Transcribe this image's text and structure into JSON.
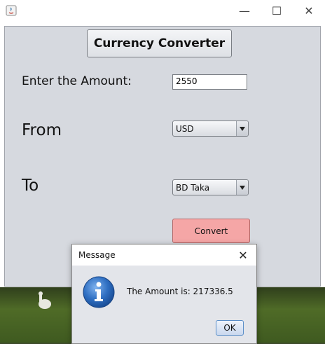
{
  "window": {
    "minimize_glyph": "—",
    "maximize_glyph": "☐",
    "close_glyph": "✕"
  },
  "form": {
    "title_button": "Currency Converter",
    "amount_label": "Enter the Amount:",
    "amount_value": "2550",
    "from_label": "From",
    "from_value": "USD",
    "to_label": "To",
    "to_value": "BD Taka",
    "convert_button": "Convert",
    "convert_color": "#f5a6a6"
  },
  "dialog": {
    "title": "Message",
    "message": "The Amount is: 217336.5",
    "ok_button": "OK",
    "icon": "info-icon"
  }
}
